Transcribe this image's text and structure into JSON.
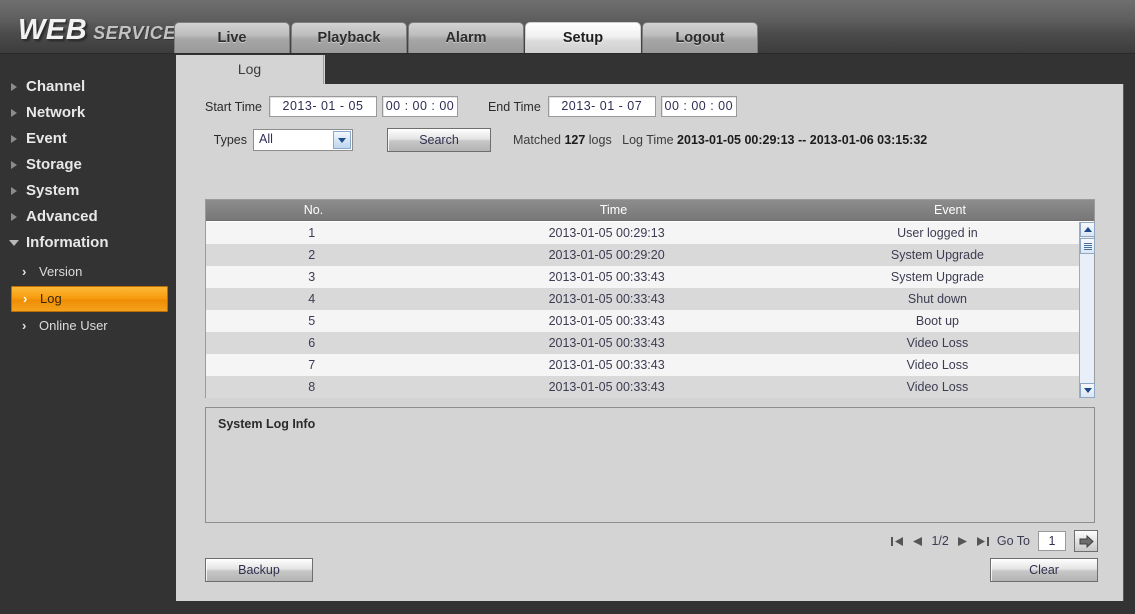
{
  "header": {
    "logo_primary": "WEB",
    "logo_secondary": "SERVICE",
    "tabs": [
      {
        "label": "Live",
        "active": false
      },
      {
        "label": "Playback",
        "active": false
      },
      {
        "label": "Alarm",
        "active": false
      },
      {
        "label": "Setup",
        "active": true
      },
      {
        "label": "Logout",
        "active": false
      }
    ]
  },
  "sidebar": {
    "items": [
      {
        "label": "Channel",
        "expanded": false
      },
      {
        "label": "Network",
        "expanded": false
      },
      {
        "label": "Event",
        "expanded": false
      },
      {
        "label": "Storage",
        "expanded": false
      },
      {
        "label": "System",
        "expanded": false
      },
      {
        "label": "Advanced",
        "expanded": false
      },
      {
        "label": "Information",
        "expanded": true
      }
    ],
    "subitems": [
      {
        "label": "Version",
        "active": false
      },
      {
        "label": "Log",
        "active": true
      },
      {
        "label": "Online User",
        "active": false
      }
    ]
  },
  "page": {
    "tab_label": "Log",
    "search": {
      "start_time_label": "Start Time",
      "start_date_value": "2013-  01  -  05",
      "start_clock_value": "00 : 00 : 00",
      "end_time_label": "End Time",
      "end_date_value": "2013-  01  -  07",
      "end_clock_value": "00 : 00 : 00",
      "types_label": "Types",
      "types_value": "All",
      "search_button": "Search",
      "matched_prefix": "Matched",
      "matched_count": "127",
      "matched_suffix": "logs",
      "logtime_label": "Log Time",
      "logtime_range": "2013-01-05 00:29:13 -- 2013-01-06 03:15:32"
    },
    "table": {
      "columns": [
        "No.",
        "Time",
        "Event"
      ],
      "rows": [
        {
          "no": "1",
          "time": "2013-01-05 00:29:13",
          "event": "User logged in"
        },
        {
          "no": "2",
          "time": "2013-01-05 00:29:20",
          "event": "System Upgrade"
        },
        {
          "no": "3",
          "time": "2013-01-05 00:33:43",
          "event": "System Upgrade"
        },
        {
          "no": "4",
          "time": "2013-01-05 00:33:43",
          "event": "Shut down"
        },
        {
          "no": "5",
          "time": "2013-01-05 00:33:43",
          "event": "Boot up"
        },
        {
          "no": "6",
          "time": "2013-01-05 00:33:43",
          "event": "Video Loss"
        },
        {
          "no": "7",
          "time": "2013-01-05 00:33:43",
          "event": "Video Loss"
        },
        {
          "no": "8",
          "time": "2013-01-05 00:33:43",
          "event": "Video Loss"
        }
      ]
    },
    "info_box": {
      "title": "System Log Info"
    },
    "pager": {
      "first_icon": "first-page-icon",
      "prev_icon": "prev-page-icon",
      "page_indicator": "1/2",
      "next_icon": "next-page-icon",
      "last_icon": "last-page-icon",
      "goto_label": "Go To",
      "goto_value": "1",
      "go_icon": "go-arrow-icon"
    },
    "footer_buttons": {
      "backup": "Backup",
      "clear": "Clear"
    }
  },
  "colors": {
    "accent_orange": "#f79d10",
    "header_dark": "#333333",
    "panel_gray": "#d4d4d4",
    "table_header_gray": "#828282"
  }
}
